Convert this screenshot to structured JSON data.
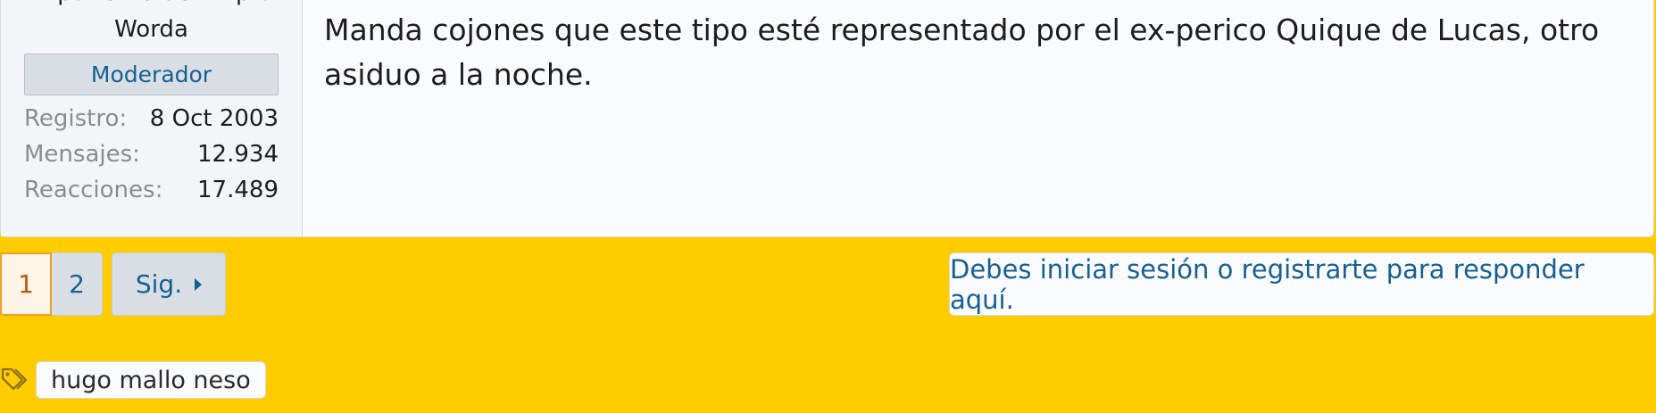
{
  "user": {
    "title_line1": "El pariento de Empta",
    "title_line2": "Worda",
    "role": "Moderador",
    "stats": [
      {
        "label": "Registro:",
        "value": "8 Oct 2003"
      },
      {
        "label": "Mensajes:",
        "value": "12.934"
      },
      {
        "label": "Reacciones:",
        "value": "17.489"
      }
    ]
  },
  "message": {
    "text": "Manda cojones que este tipo esté representado por el ex-perico Quique de Lucas, otro asiduo a la noche."
  },
  "pagination": {
    "pages": [
      "1",
      "2"
    ],
    "current": "1",
    "next_label": "Sig."
  },
  "reply": {
    "label": "Debes iniciar sesión o registrarte para responder aquí."
  },
  "tags": {
    "icon": "tags-icon",
    "items": [
      "hugo mallo neso"
    ]
  },
  "colors": {
    "page_background": "#ffcc00",
    "link": "#176093",
    "current_page_border": "#f39d2b"
  }
}
